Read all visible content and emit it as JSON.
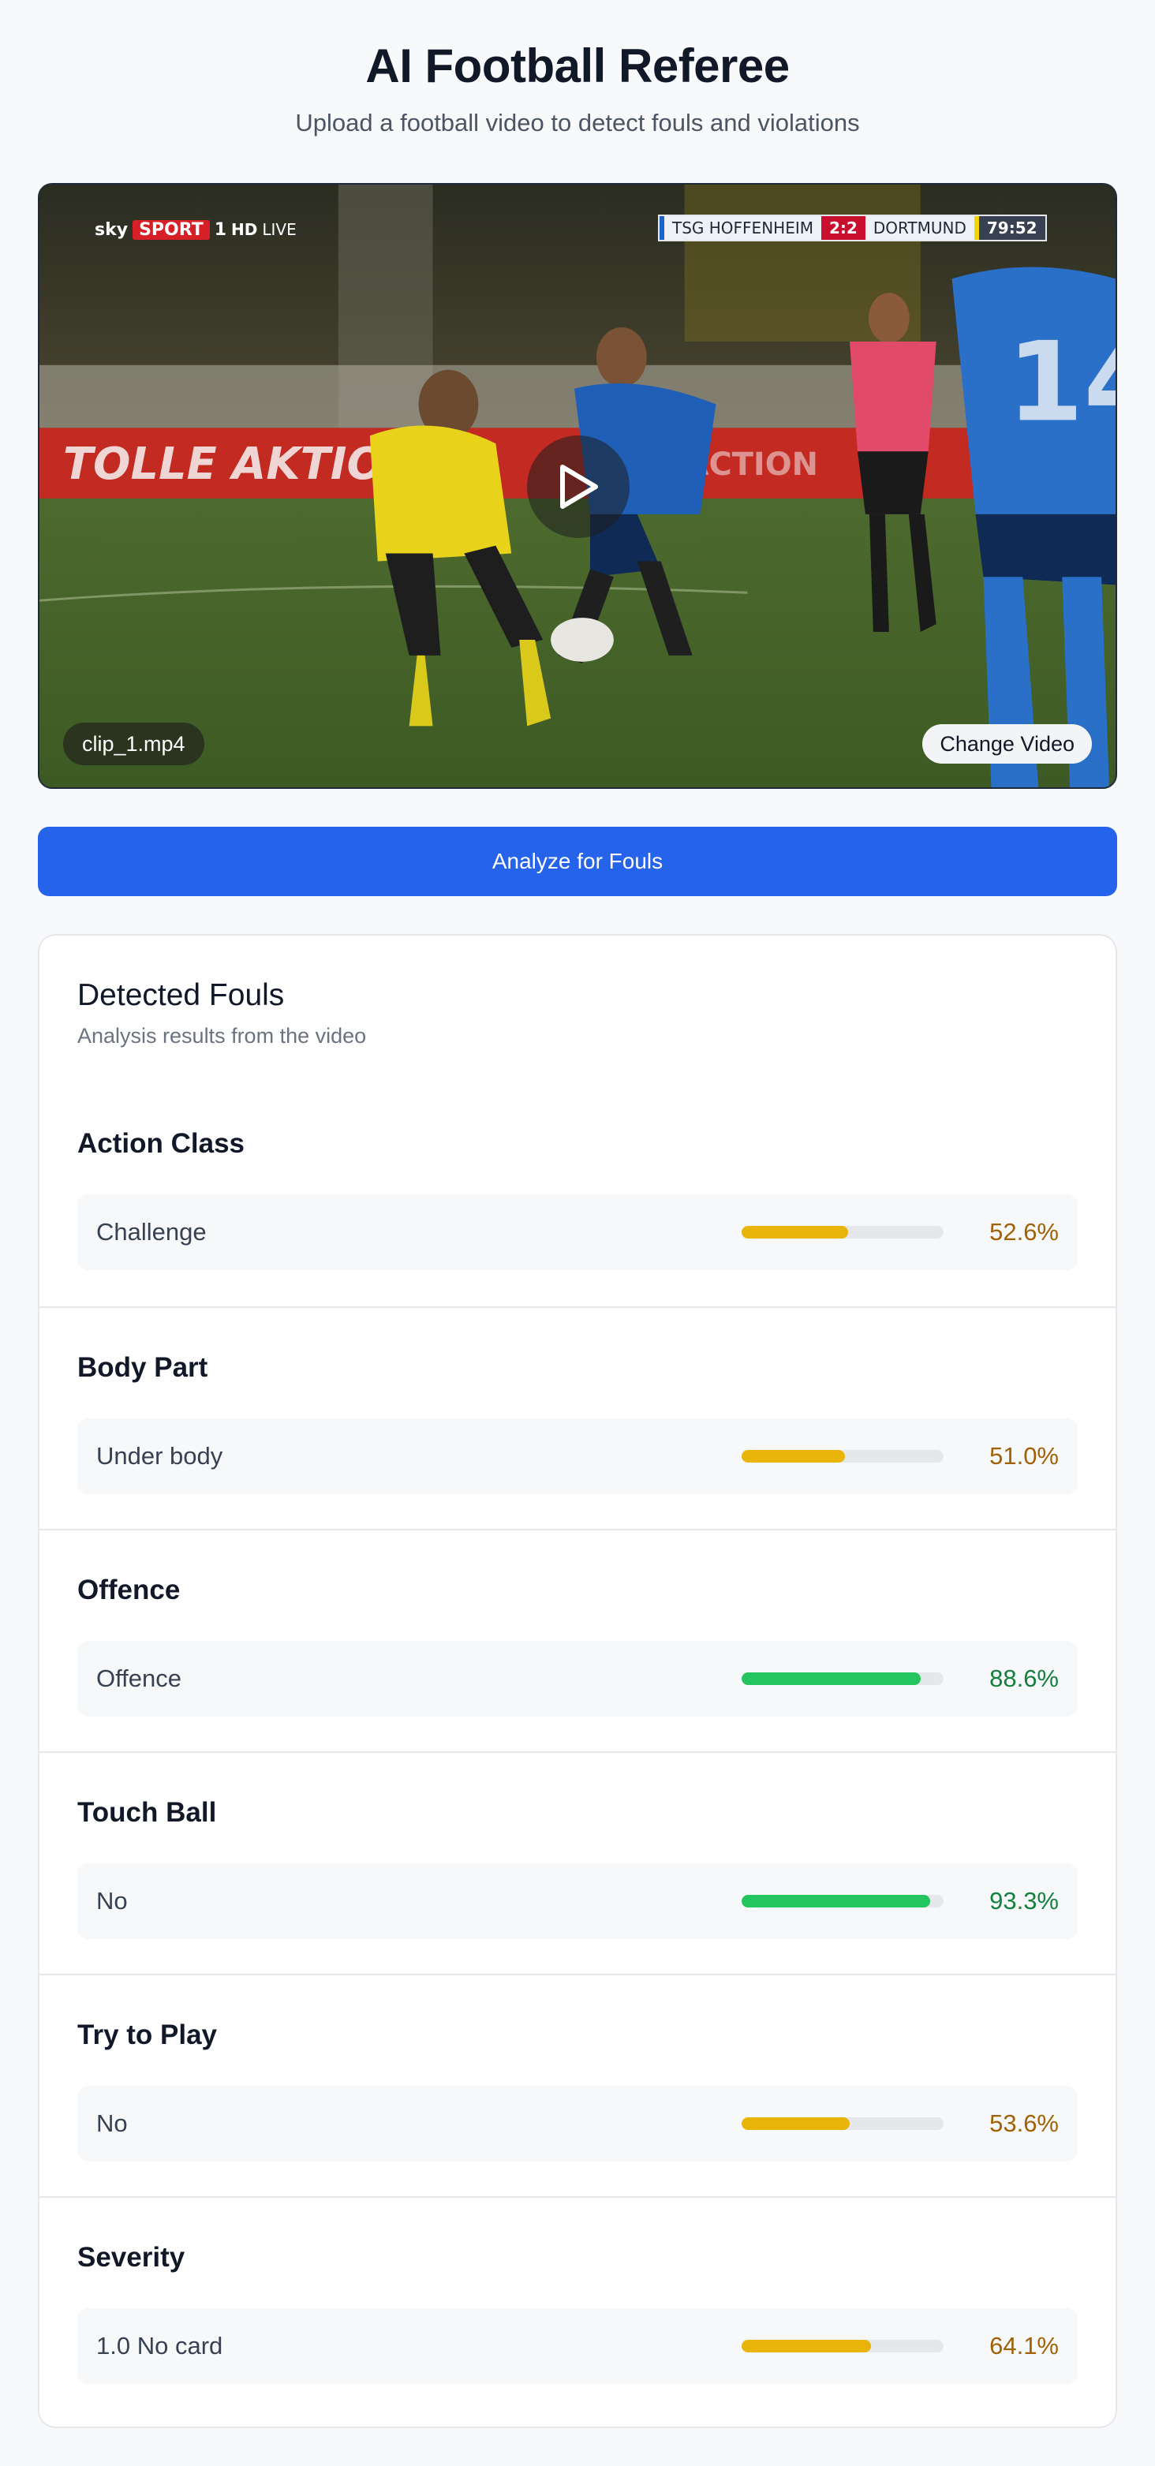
{
  "header": {
    "title": "AI Football Referee",
    "subtitle": "Upload a football video to detect fouls and violations"
  },
  "video": {
    "broadcast": {
      "brand": "sky",
      "sport": "SPORT",
      "channel": "1",
      "hd": "HD",
      "live": "LIVE"
    },
    "scoreboard": {
      "home": "TSG HOFFENHEIM",
      "score": "2:2",
      "away": "DORTMUND",
      "clock": "79:52"
    },
    "filename": "clip_1.mp4",
    "change_label": "Change Video",
    "play_icon": "play-icon"
  },
  "analyze_label": "Analyze for Fouls",
  "results": {
    "title": "Detected Fouls",
    "subtitle": "Analysis results from the video",
    "sections": [
      {
        "title": "Action Class",
        "label": "Challenge",
        "percent": 52.6,
        "percent_text": "52.6%",
        "level": "medium"
      },
      {
        "title": "Body Part",
        "label": "Under body",
        "percent": 51.0,
        "percent_text": "51.0%",
        "level": "medium"
      },
      {
        "title": "Offence",
        "label": "Offence",
        "percent": 88.6,
        "percent_text": "88.6%",
        "level": "high"
      },
      {
        "title": "Touch Ball",
        "label": "No",
        "percent": 93.3,
        "percent_text": "93.3%",
        "level": "high"
      },
      {
        "title": "Try to Play",
        "label": "No",
        "percent": 53.6,
        "percent_text": "53.6%",
        "level": "medium"
      },
      {
        "title": "Severity",
        "label": "1.0 No card",
        "percent": 64.1,
        "percent_text": "64.1%",
        "level": "medium"
      }
    ]
  },
  "colors": {
    "primary": "#2563eb",
    "medium_bar": "#eab308",
    "medium_text": "#a16207",
    "high_bar": "#22c55e",
    "high_text": "#15803d"
  }
}
